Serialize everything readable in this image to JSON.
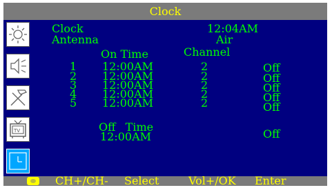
{
  "title": "Clock",
  "sidebar": {
    "icons": [
      {
        "name": "picture-brightness-icon"
      },
      {
        "name": "sound-speaker-icon"
      },
      {
        "name": "setup-tools-icon"
      },
      {
        "name": "tv-channel-icon"
      },
      {
        "name": "clock-timer-icon",
        "selected": true
      }
    ]
  },
  "clock": {
    "label": "Clock",
    "value": "12:04AM"
  },
  "antenna": {
    "label": "Antenna",
    "value": "Air"
  },
  "headers": {
    "on_time": "On Time",
    "channel": "Channel"
  },
  "timers": [
    {
      "num": "1",
      "time": "12:00AM",
      "channel": "2",
      "state": "Off"
    },
    {
      "num": "2",
      "time": "12:00AM",
      "channel": "2",
      "state": "Off"
    },
    {
      "num": "3",
      "time": "12:00AM",
      "channel": "2",
      "state": "Off"
    },
    {
      "num": "4",
      "time": "12:00AM",
      "channel": "2",
      "state": "Off"
    },
    {
      "num": "5",
      "time": "12:00AM",
      "channel": "2",
      "state": "Off"
    }
  ],
  "off_timer": {
    "label": "Off  Time",
    "time": "12:00AM",
    "state": "Off"
  },
  "footer": {
    "nav": "CH+/CH-",
    "select": "Select",
    "vol": "Vol+/OK",
    "enter": "Enter"
  },
  "colors": {
    "background": "#000080",
    "text": "#00ff00",
    "title": "#ffff00",
    "bar": "#7b7b7b",
    "selected": "#00a6ff"
  }
}
